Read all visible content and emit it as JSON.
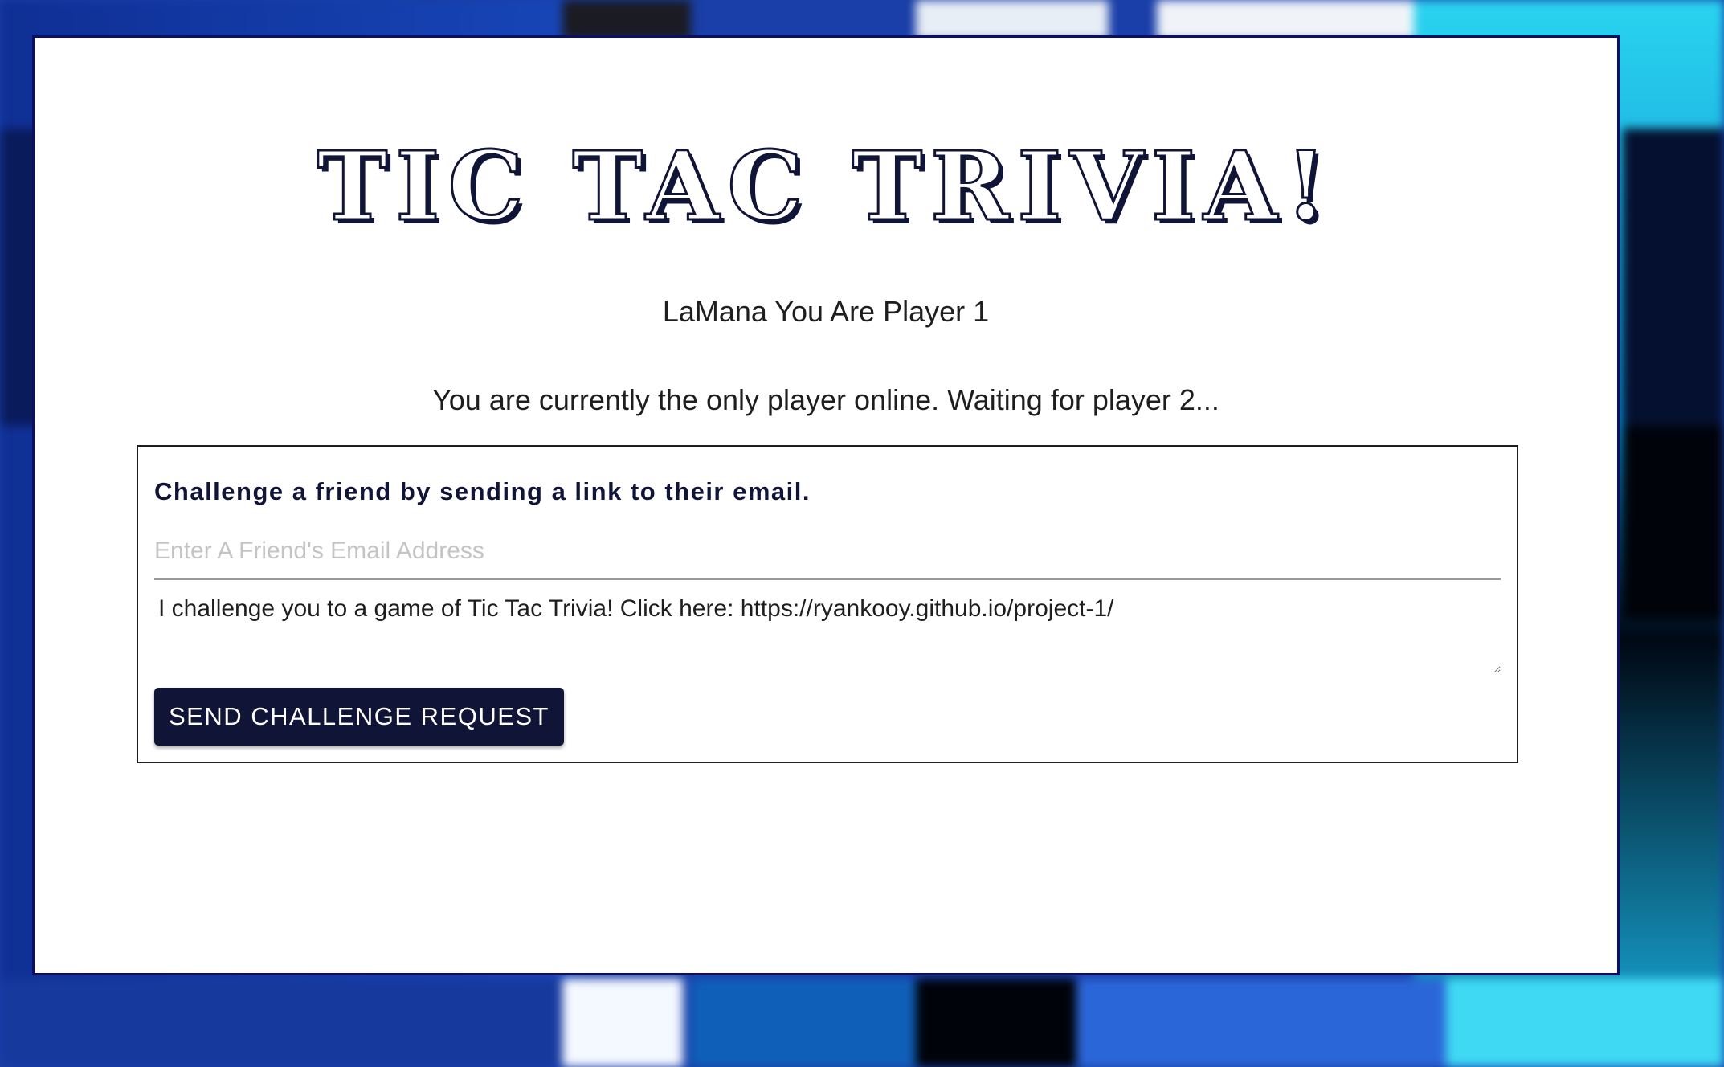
{
  "header": {
    "title": "TIC TAC TRIVIA!"
  },
  "status": {
    "player_label": "LaMana You Are Player 1",
    "waiting_label": "You are currently the only player online. Waiting for player 2..."
  },
  "challenge": {
    "heading": "Challenge a friend by sending a link to their email.",
    "email_placeholder": "Enter A Friend's Email Address",
    "email_value": "",
    "message_value": "I challenge you to a game of Tic Tac Trivia! Click here: https://ryankooy.github.io/project-1/",
    "send_label": "SEND CHALLENGE REQUEST"
  },
  "colors": {
    "primary": "#101437",
    "panel_border": "#0d0d6b",
    "background": "#ffffff"
  }
}
